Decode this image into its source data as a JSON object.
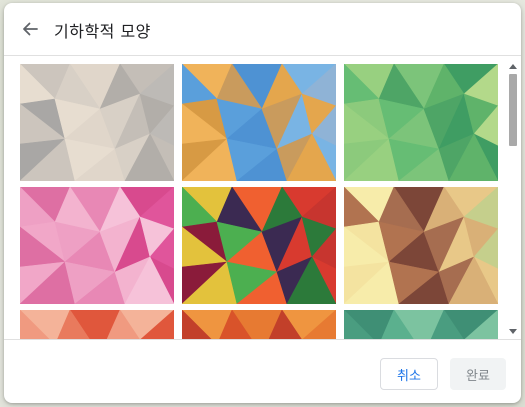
{
  "dialog": {
    "title": "기하학적 모양",
    "back_icon": "arrow-left-icon",
    "cancel_label": "취소",
    "done_label": "완료"
  },
  "colors": {
    "accent": "#1a73e8",
    "divider": "#e0e0e0",
    "disabled_bg": "#f1f3f4",
    "disabled_text": "#80868b"
  },
  "thumbnails": [
    {
      "name": "neutral-gray-beige",
      "colors": [
        "#ccc5bd",
        "#d8d0c6",
        "#bdbab6",
        "#e7ddd0",
        "#c4beb7",
        "#a9a7a5",
        "#e0d6ca",
        "#b2aea9"
      ]
    },
    {
      "name": "orange-blue",
      "colors": [
        "#e4a64d",
        "#f0b35a",
        "#c99b5d",
        "#8fb3d6",
        "#5a9fdb",
        "#79b4e4",
        "#d79a44",
        "#4e92d3"
      ]
    },
    {
      "name": "green",
      "colors": [
        "#7cc47a",
        "#5fb36a",
        "#98d080",
        "#4ea566",
        "#b3d98a",
        "#66bd74",
        "#3f9d63",
        "#8cca7c"
      ]
    },
    {
      "name": "pink",
      "colors": [
        "#f1a7c8",
        "#e888b5",
        "#f6c2d9",
        "#de6fa3",
        "#f3b3cf",
        "#e0559b",
        "#eea0c4",
        "#d84a8e"
      ]
    },
    {
      "name": "multicolor-red-green",
      "colors": [
        "#d83a2f",
        "#8a1b3a",
        "#f06030",
        "#2c7a3a",
        "#e3c23c",
        "#3b2a52",
        "#c7352f",
        "#4caf50"
      ]
    },
    {
      "name": "brown-yellow",
      "colors": [
        "#b17350",
        "#e8c888",
        "#f4e3a0",
        "#7c4638",
        "#d9b077",
        "#f7ecaa",
        "#a66d50",
        "#c5cf8c"
      ]
    },
    {
      "name": "orange-peach",
      "colors": [
        "#e0573c",
        "#f09a80",
        "#f4b399",
        "#e97a5d"
      ]
    },
    {
      "name": "orange-red",
      "colors": [
        "#d9532a",
        "#e77a32",
        "#c2402a",
        "#ef9540"
      ]
    },
    {
      "name": "green-teal",
      "colors": [
        "#3f8f75",
        "#5bb08e",
        "#7cc3a0",
        "#4a9d80"
      ]
    }
  ]
}
